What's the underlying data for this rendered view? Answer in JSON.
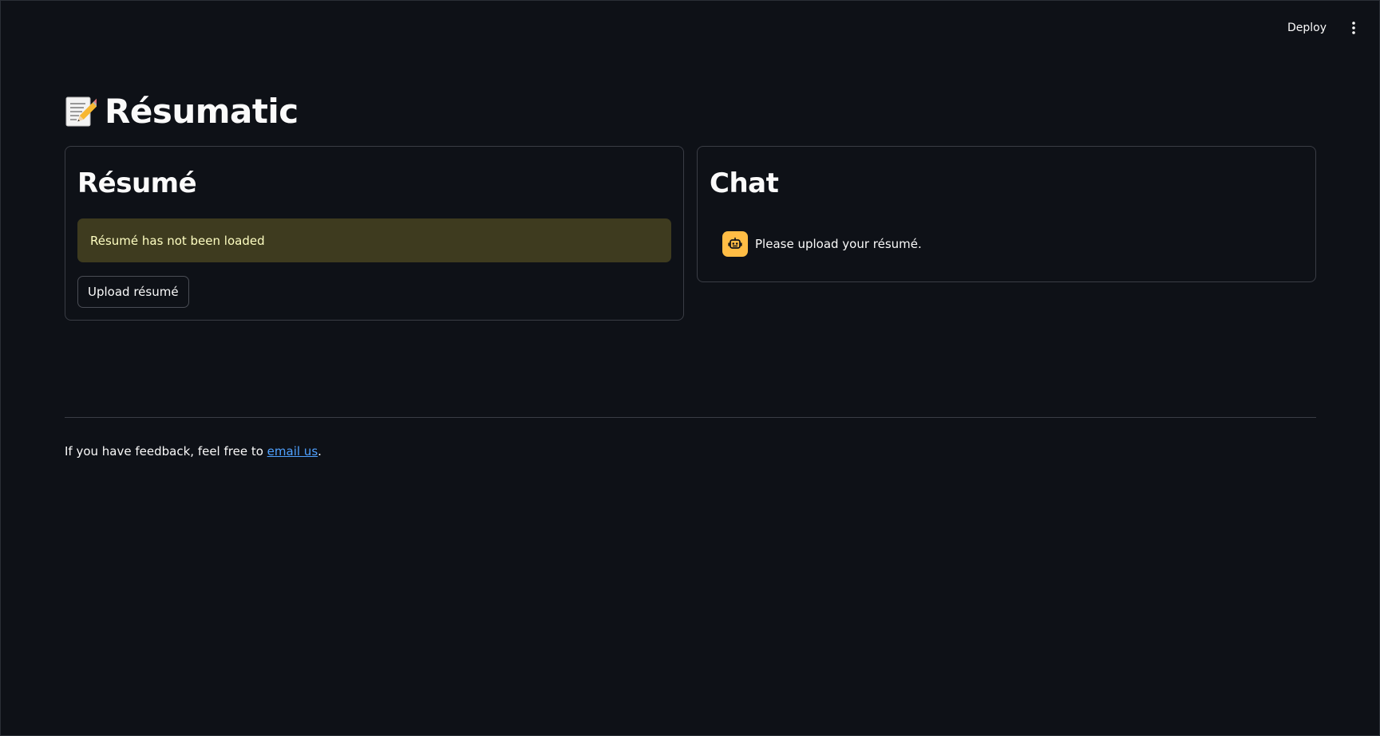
{
  "header": {
    "deploy_label": "Deploy",
    "menu_icon": "vertical-ellipsis-icon"
  },
  "app": {
    "title_icon": "memo-pencil-icon",
    "title": "Résumatic"
  },
  "resume_panel": {
    "heading": "Résumé",
    "warning": "Résumé has not been loaded",
    "upload_label": "Upload résumé"
  },
  "chat_panel": {
    "heading": "Chat",
    "avatar_icon": "robot-icon",
    "message": "Please upload your résumé."
  },
  "footer": {
    "text_before": "If you have feedback, feel free to ",
    "link_text": "email us",
    "text_after": "."
  },
  "colors": {
    "background": "#0e1117",
    "warning_bg": "#3e3b1f",
    "warning_text": "#ffffc2",
    "avatar_bg": "#ffbd45",
    "link": "#4fa1ff"
  }
}
